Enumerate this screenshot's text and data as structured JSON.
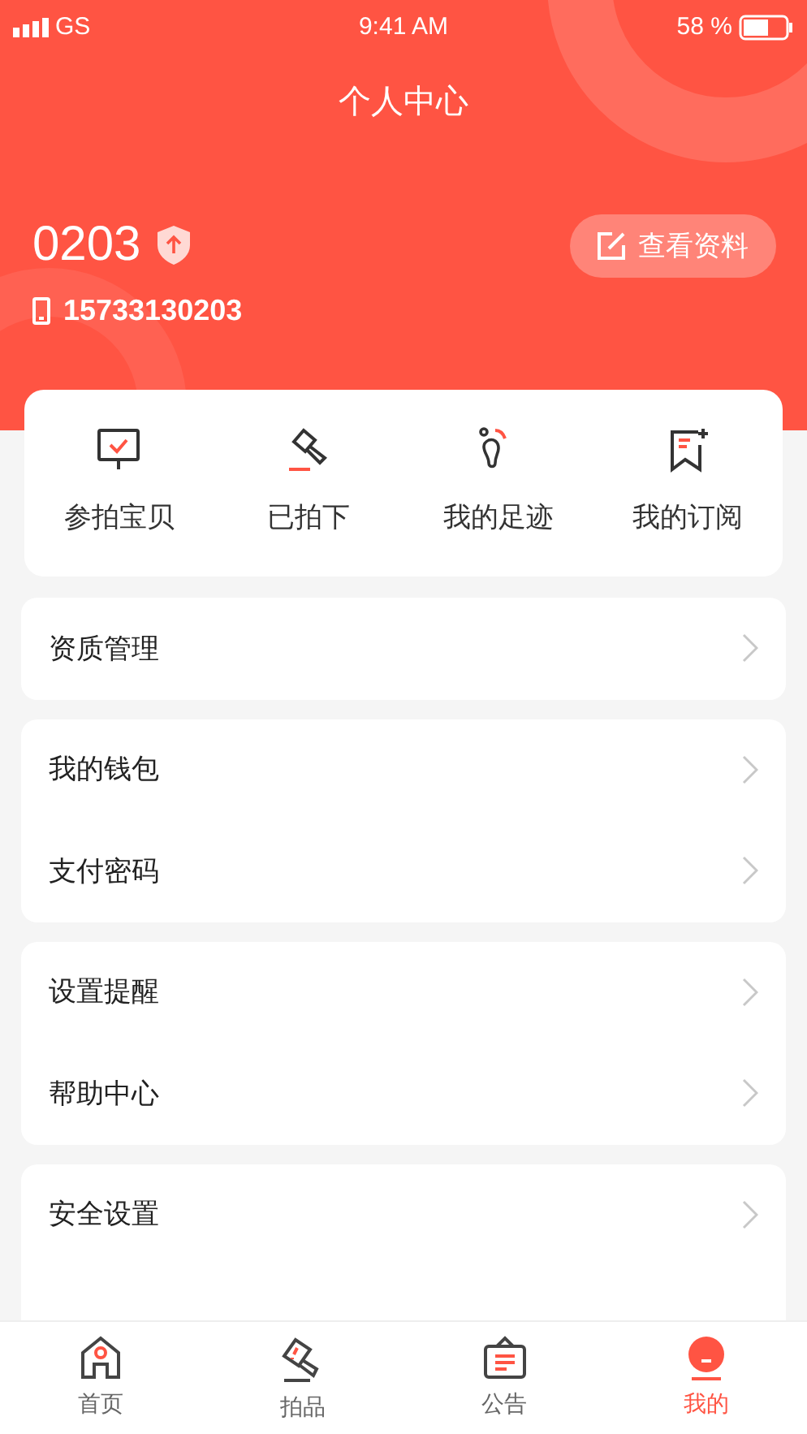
{
  "status_bar": {
    "carrier": "GS",
    "time": "9:41 AM",
    "battery": "58 %"
  },
  "title": "个人中心",
  "profile": {
    "name": "0203",
    "phone": "15733130203",
    "view_button": "查看资料"
  },
  "shortcuts": [
    {
      "kind": "bid",
      "label": "参拍宝贝"
    },
    {
      "kind": "won",
      "label": "已拍下"
    },
    {
      "kind": "footprint",
      "label": "我的足迹"
    },
    {
      "kind": "subscribe",
      "label": "我的订阅"
    }
  ],
  "menu_groups": [
    {
      "items": [
        "资质管理"
      ]
    },
    {
      "items": [
        "我的钱包",
        "支付密码"
      ]
    },
    {
      "items": [
        "设置提醒",
        "帮助中心"
      ]
    },
    {
      "items": [
        "安全设置"
      ]
    }
  ],
  "tab_bar": [
    {
      "kind": "home",
      "label": "首页",
      "selected": false
    },
    {
      "kind": "auction",
      "label": "拍品",
      "selected": false
    },
    {
      "kind": "notice",
      "label": "公告",
      "selected": false
    },
    {
      "kind": "me",
      "label": "我的",
      "selected": true
    }
  ]
}
